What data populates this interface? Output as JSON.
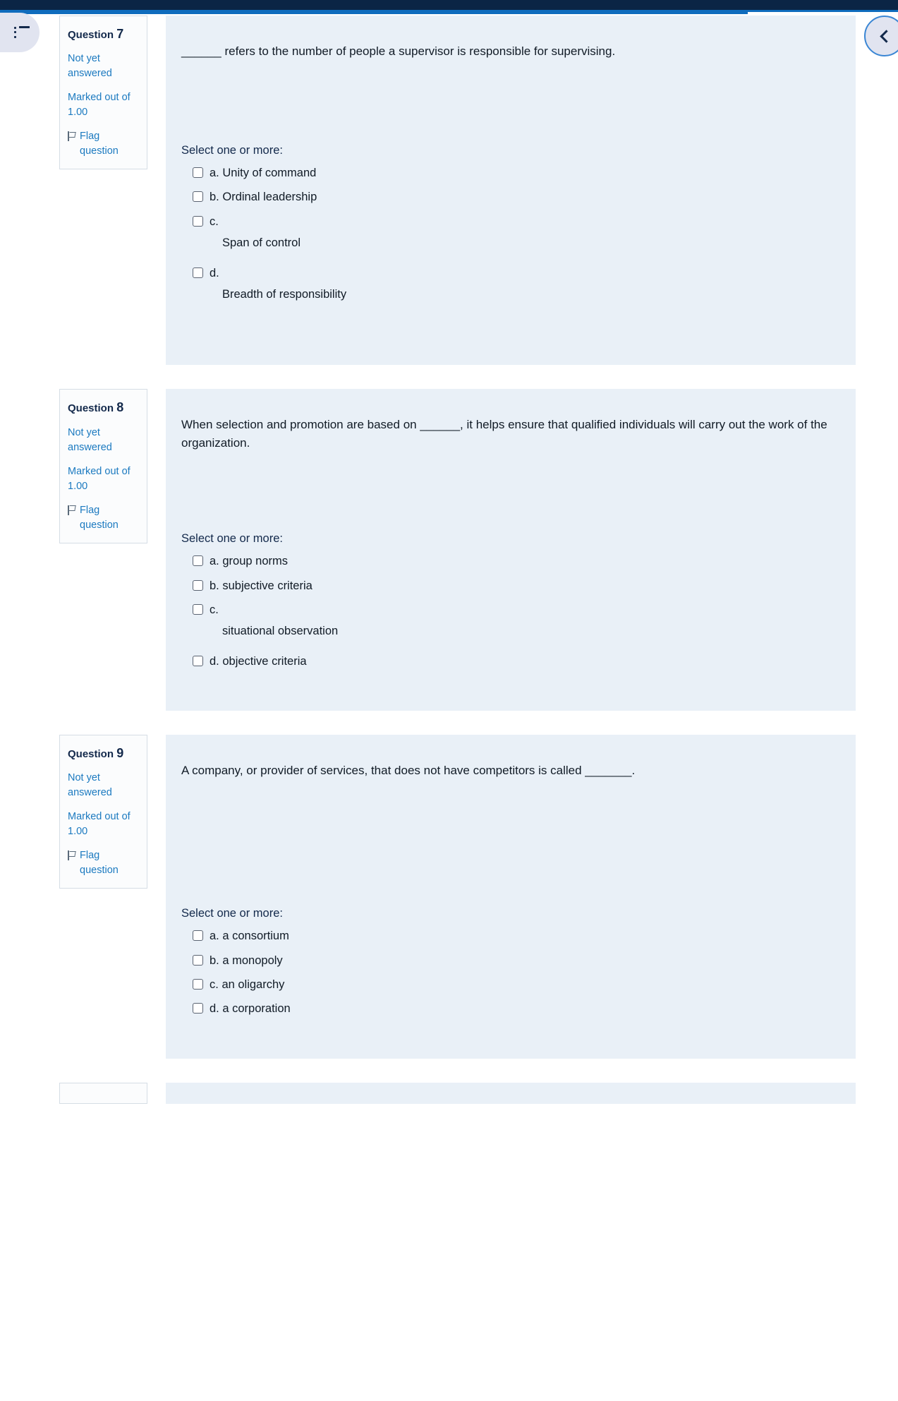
{
  "browser": {
    "chrome_color": "#0b2545",
    "accent_color": "#0f6cbd"
  },
  "nav": {
    "menu_icon": "list-menu-icon",
    "menu_label": "",
    "collapse_icon": "chevron-left-icon",
    "collapse_label": ""
  },
  "labels": {
    "question_word": "Question",
    "not_answered": "Not yet answered",
    "marked_out_of": "Marked out of 1.00",
    "flag_question": "Flag question",
    "select_prompt": "Select one or more:"
  },
  "questions": [
    {
      "number": "7",
      "state": "Not yet answered",
      "marks": "Marked out of 1.00",
      "flag": "Flag question",
      "text": "______ refers to the number of people a supervisor is responsible for supervising.",
      "prompt": "Select one or more:",
      "options": [
        {
          "letter": "a.",
          "label": "Unity of command",
          "wrapped": false,
          "checked": false
        },
        {
          "letter": "b.",
          "label": "Ordinal leadership",
          "wrapped": false,
          "checked": false
        },
        {
          "letter": "c.",
          "label": "Span of control",
          "wrapped": true,
          "checked": false
        },
        {
          "letter": "d.",
          "label": "Breadth of responsibility",
          "wrapped": true,
          "checked": false
        }
      ]
    },
    {
      "number": "8",
      "state": "Not yet answered",
      "marks": "Marked out of 1.00",
      "flag": "Flag question",
      "text": "When selection and promotion are based on ______, it helps ensure that qualified individuals will carry out the work of the organization.",
      "prompt": "Select one or more:",
      "options": [
        {
          "letter": "a.",
          "label": "group norms",
          "wrapped": false,
          "checked": false
        },
        {
          "letter": "b.",
          "label": "subjective criteria",
          "wrapped": false,
          "checked": false
        },
        {
          "letter": "c.",
          "label": "situational observation",
          "wrapped": true,
          "checked": false
        },
        {
          "letter": "d.",
          "label": "objective criteria",
          "wrapped": false,
          "checked": false
        }
      ]
    },
    {
      "number": "9",
      "state": "Not yet answered",
      "marks": "Marked out of 1.00",
      "flag": "Flag question",
      "text": "A company, or provider of services, that does not have competitors is called _______.",
      "prompt": "Select one or more:",
      "options": [
        {
          "letter": "a.",
          "label": "a consortium",
          "wrapped": false,
          "checked": false
        },
        {
          "letter": "b.",
          "label": "a monopoly",
          "wrapped": false,
          "checked": false
        },
        {
          "letter": "c.",
          "label": "an oligarchy",
          "wrapped": false,
          "checked": false
        },
        {
          "letter": "d.",
          "label": "a corporation",
          "wrapped": false,
          "checked": false
        }
      ]
    }
  ]
}
